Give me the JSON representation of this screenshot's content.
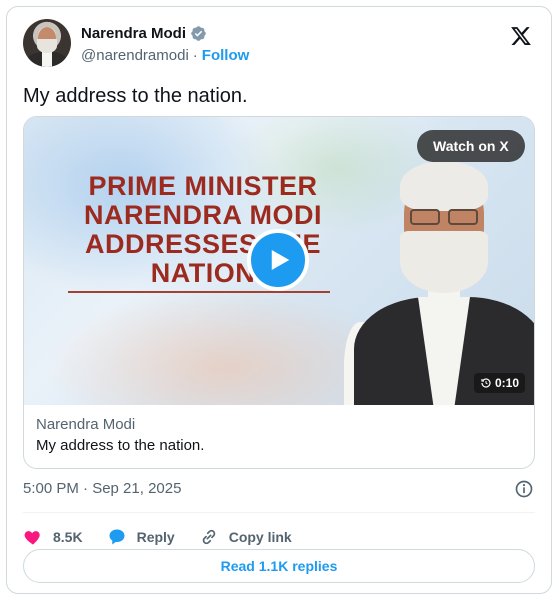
{
  "author": {
    "name": "Narendra Modi",
    "handle": "@narendramodi",
    "separator": "·",
    "follow_label": "Follow"
  },
  "tweet": {
    "text": "My address to the nation."
  },
  "media": {
    "headline": "PRIME MINISTER\nNARENDRA MODI\nADDRESSES THE\nNATION",
    "watch_label": "Watch on X",
    "duration": "0:10",
    "card_name": "Narendra Modi",
    "card_text": "My address to the nation."
  },
  "timestamp": "5:00 PM · Sep 21, 2025",
  "actions": {
    "like_count": "8.5K",
    "reply_label": "Reply",
    "copy_label": "Copy link"
  },
  "replies_button": "Read 1.1K replies",
  "colors": {
    "accent": "#1d9bf0",
    "like": "#f91880",
    "text": "#0f1419",
    "muted": "#536471"
  }
}
